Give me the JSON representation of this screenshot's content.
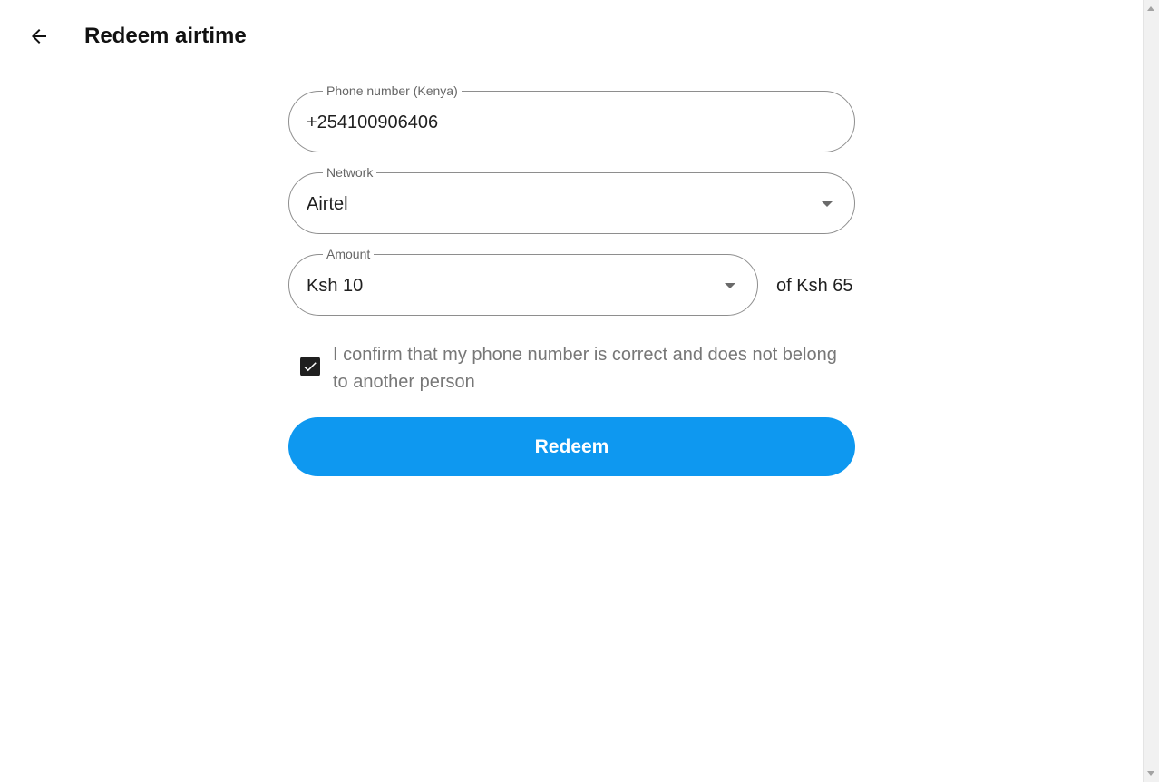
{
  "header": {
    "title": "Redeem airtime",
    "back_icon": "arrow-left-icon"
  },
  "form": {
    "phone": {
      "label": "Phone number (Kenya)",
      "value": "+254100906406"
    },
    "network": {
      "label": "Network",
      "value": "Airtel"
    },
    "amount": {
      "label": "Amount",
      "value": "Ksh 10",
      "balance_text": "of Ksh 65"
    },
    "confirm": {
      "checked": true,
      "text": "I confirm that my phone number is correct and does not belong to another person"
    },
    "submit_label": "Redeem"
  },
  "colors": {
    "primary": "#0e98f0",
    "checkbox": "#1f1f1f",
    "border": "#8e8e8e"
  }
}
